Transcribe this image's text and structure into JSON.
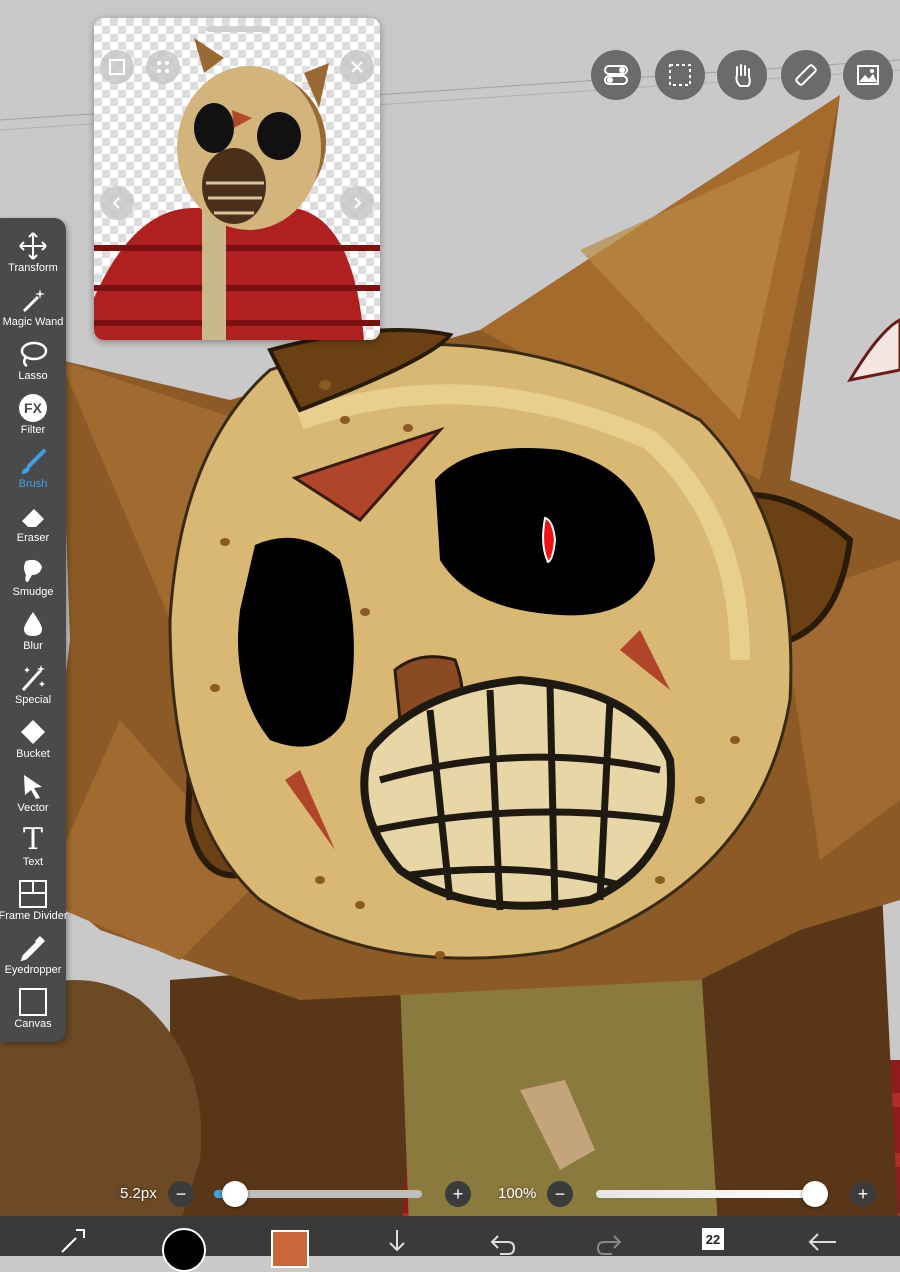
{
  "tools": [
    {
      "label": "Transform",
      "icon": "transform-icon"
    },
    {
      "label": "Magic Wand",
      "icon": "magic-wand-icon"
    },
    {
      "label": "Lasso",
      "icon": "lasso-icon"
    },
    {
      "label": "Filter",
      "icon": "fx-icon",
      "glyph": "FX"
    },
    {
      "label": "Brush",
      "icon": "brush-icon",
      "active": true
    },
    {
      "label": "Eraser",
      "icon": "eraser-icon"
    },
    {
      "label": "Smudge",
      "icon": "smudge-icon"
    },
    {
      "label": "Blur",
      "icon": "blur-icon"
    },
    {
      "label": "Special",
      "icon": "special-icon"
    },
    {
      "label": "Bucket",
      "icon": "bucket-icon"
    },
    {
      "label": "Vector",
      "icon": "vector-icon"
    },
    {
      "label": "Text",
      "icon": "text-icon",
      "glyph": "T"
    },
    {
      "label": "Frame Divider",
      "icon": "frame-divider-icon"
    },
    {
      "label": "Eyedropper",
      "icon": "eyedropper-icon"
    },
    {
      "label": "Canvas",
      "icon": "canvas-icon"
    }
  ],
  "brush_size": {
    "label": "5.2px",
    "level": 0.08
  },
  "opacity": {
    "label": "100%",
    "level": 1.0
  },
  "layer_count": "22",
  "colors": {
    "current": "#c8673a",
    "accent": "#3fa0e8",
    "toolbar": "#4a4a4a"
  }
}
